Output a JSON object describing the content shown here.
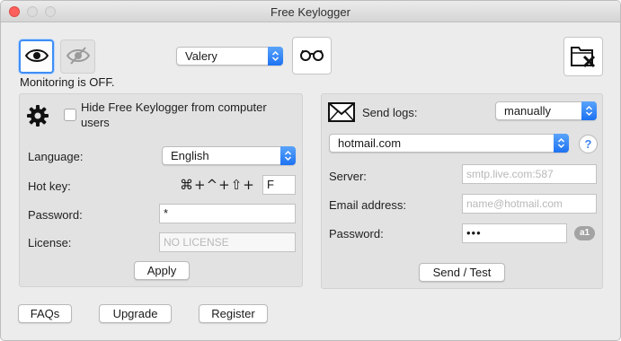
{
  "window": {
    "title": "Free Keylogger"
  },
  "top": {
    "user_select": "Valery",
    "monitoring_status": "Monitoring is OFF."
  },
  "general": {
    "hide_label": "Hide Free Keylogger from computer users",
    "hide_checked": false,
    "language_label": "Language:",
    "language_value": "English",
    "hotkey_label": "Hot key:",
    "hotkey_modifiers": "⌘+^+⇧+",
    "hotkey_key": "F",
    "password_label": "Password:",
    "password_value": "*",
    "license_label": "License:",
    "license_placeholder": "NO LICENSE",
    "apply_label": "Apply"
  },
  "logs": {
    "send_label": "Send logs:",
    "send_mode": "manually",
    "provider": "hotmail.com",
    "help_label": "?",
    "server_label": "Server:",
    "server_placeholder": "smtp.live.com:587",
    "email_label": "Email address:",
    "email_placeholder": "name@hotmail.com",
    "password_label": "Password:",
    "password_value": "•••",
    "password_badge": "a1",
    "send_test_label": "Send / Test"
  },
  "footer": {
    "faqs_label": "FAQs",
    "upgrade_label": "Upgrade",
    "register_label": "Register"
  },
  "colors": {
    "accent": "#3f8ef6",
    "close_button": "#fc605c",
    "panel_bg": "#e2e2e2",
    "window_bg": "#ececec"
  }
}
